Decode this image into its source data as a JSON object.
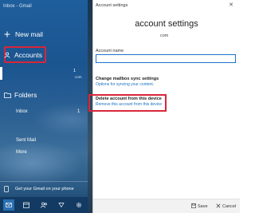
{
  "window": {
    "title": "Inbox - Gmail"
  },
  "nav": {
    "new_mail_label": "New mail",
    "accounts_label": "Accounts",
    "account_count": "1",
    "account_count_secondary": "com",
    "folders_label": "Folders",
    "folders": [
      {
        "label": "Inbox",
        "count": "1"
      },
      {
        "label": "Sent Mail"
      },
      {
        "label": "More"
      }
    ],
    "promo_label": "Get your Gmail on your phone"
  },
  "toolbar": {
    "icons": [
      "mail-icon",
      "calendar-icon",
      "people-icon",
      "feedback-icon",
      "settings-icon"
    ],
    "active": "mail-icon"
  },
  "settings": {
    "title_bar": "Account settings",
    "heading": "account settings",
    "email_suffix": "com",
    "account_name_label": "Account name",
    "account_name_value": "",
    "sync_heading": "Change mailbox sync settings",
    "sync_link": "Options for syncing your content.",
    "delete_heading": "Delete account from this device",
    "delete_link": "Remove this account from this device",
    "save_label": "Save",
    "cancel_label": "Cancel"
  },
  "colors": {
    "accent": "#1a73c9",
    "link": "#1a6fc2",
    "highlight": "#d8263a",
    "sidebar_bg": "#1e5e9c"
  }
}
